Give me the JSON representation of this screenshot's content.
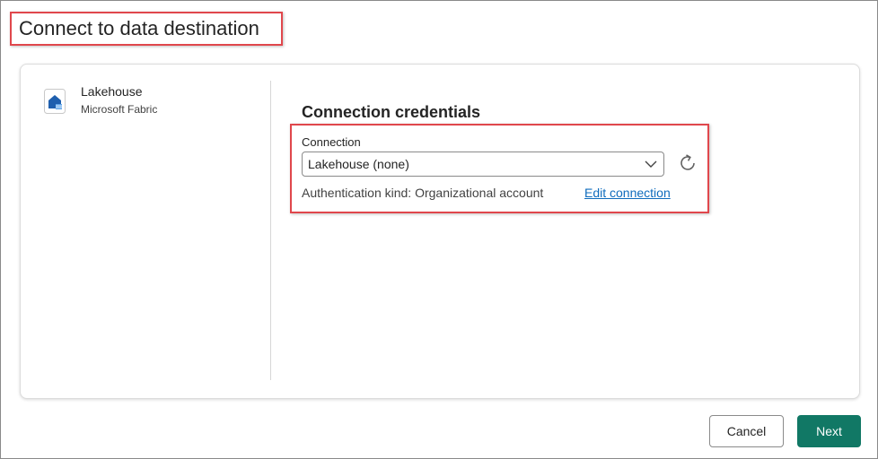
{
  "dialog": {
    "title": "Connect to data destination"
  },
  "source": {
    "name": "Lakehouse",
    "provider": "Microsoft Fabric",
    "icon": "lakehouse-icon"
  },
  "credentials": {
    "section_title": "Connection credentials",
    "connection_label": "Connection",
    "connection_value": "Lakehouse (none)",
    "auth_text": "Authentication kind: Organizational account",
    "edit_link": "Edit connection"
  },
  "footer": {
    "cancel_label": "Cancel",
    "next_label": "Next"
  },
  "colors": {
    "accent": "#117865",
    "link": "#0f6cbd",
    "highlight": "#e0474c"
  }
}
